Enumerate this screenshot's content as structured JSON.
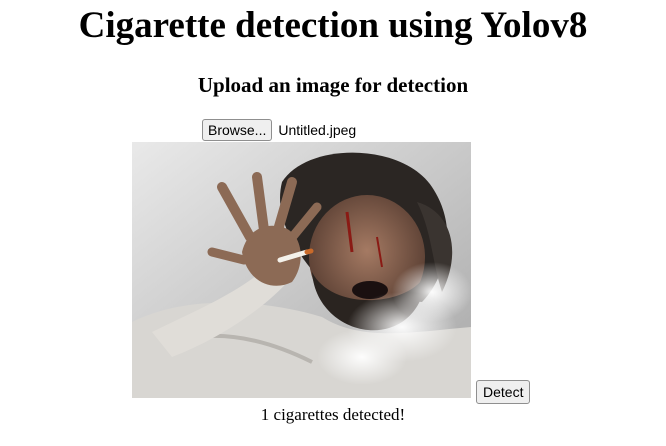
{
  "header": {
    "title": "Cigarette detection using Yolov8",
    "subtitle": "Upload an image for detection"
  },
  "upload": {
    "browse_label": "Browse...",
    "file_name": "Untitled.jpeg"
  },
  "preview": {
    "alt": "Uploaded image preview"
  },
  "actions": {
    "detect_label": "Detect"
  },
  "result": {
    "message": "1 cigarettes detected!"
  }
}
